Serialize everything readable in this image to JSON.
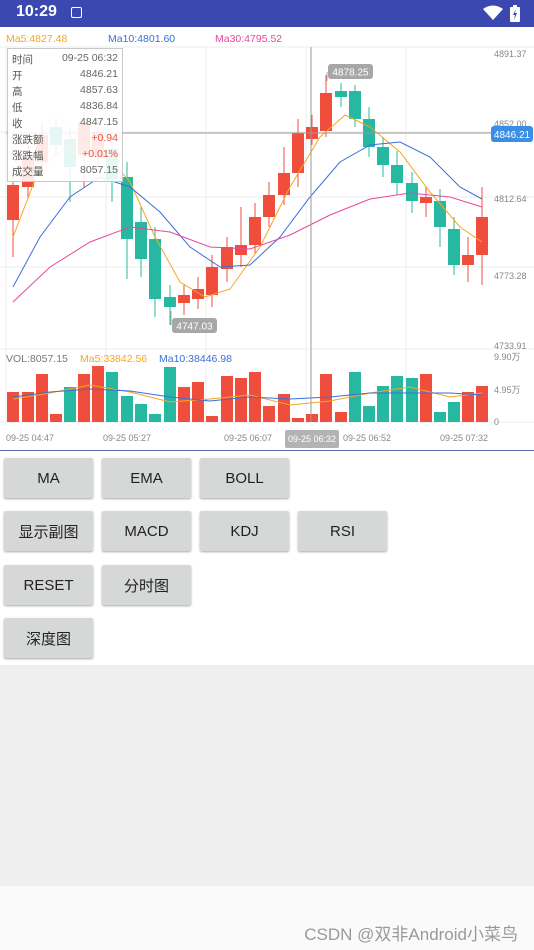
{
  "status_bar": {
    "time": "10:29"
  },
  "chart": {
    "legend": {
      "ma5": "Ma5:4827.48",
      "ma10": "Ma10:4801.60",
      "ma30": "Ma30:4795.52"
    },
    "price_axis": [
      "4891.37",
      "4852.00",
      "4812.64",
      "4773.28",
      "4733.91"
    ],
    "high_label": "4878.25",
    "low_label": "4747.03",
    "cursor_price": "4846.21",
    "vol_legend": {
      "vol": "VOL:8057.15",
      "ma5": "Ma5:33842.56",
      "ma10": "Ma10:38446.98"
    },
    "vol_axis": [
      "9.90万",
      "4.95万",
      "0"
    ],
    "time_axis": [
      "09-25 04:47",
      "09-25 05:27",
      "09-25 06:07",
      "09-25 06:32",
      "09-25 06:52",
      "09-25 07:32"
    ],
    "info": {
      "rows": [
        {
          "k": "时间",
          "v": "09-25 06:32"
        },
        {
          "k": "开",
          "v": "4846.21"
        },
        {
          "k": "高",
          "v": "4857.63"
        },
        {
          "k": "低",
          "v": "4836.84"
        },
        {
          "k": "收",
          "v": "4847.15"
        },
        {
          "k": "涨跌额",
          "v": "+0.94"
        },
        {
          "k": "涨跌幅",
          "v": "+0.01%"
        },
        {
          "k": "成交量",
          "v": "8057.15"
        }
      ]
    },
    "colors": {
      "up": "#f04e3d",
      "down": "#26b8a0",
      "ma5": "#f5a623",
      "ma10": "#3b6fd8",
      "ma30": "#e8489a"
    }
  },
  "buttons": {
    "ma": "MA",
    "ema": "EMA",
    "boll": "BOLL",
    "sub_chart": "显示副图",
    "macd": "MACD",
    "kdj": "KDJ",
    "rsi": "RSI",
    "reset": "RESET",
    "time_share": "分时图",
    "depth": "深度图"
  },
  "footer": {
    "watermark": "CSDN @双非Android小菜鸟"
  }
}
